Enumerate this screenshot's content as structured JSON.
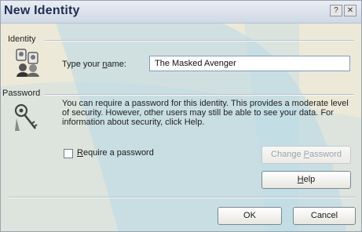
{
  "dialog": {
    "title": "New Identity",
    "title_help_glyph": "?",
    "title_close_glyph": "✕"
  },
  "identity": {
    "group_label": "Identity",
    "name_label_pre": "Type your ",
    "name_label_accel": "n",
    "name_label_post": "ame:",
    "name_value": "The Masked Avenger"
  },
  "password": {
    "group_label": "Password",
    "description": "You can require a password for this identity.  This provides a moderate level of security. However, other users may still be able to see your data. For information about security, click Help.",
    "checkbox_accel": "R",
    "checkbox_label_rest": "equire a password",
    "checkbox_checked": false,
    "change_password_pre": "Change ",
    "change_password_accel": "P",
    "change_password_post": "assword",
    "help_accel": "H",
    "help_label_rest": "elp"
  },
  "footer": {
    "ok_label": "OK",
    "cancel_label": "Cancel"
  },
  "icons": {
    "identity_icon": "people-icon",
    "password_icon": "keys-icon"
  },
  "colors": {
    "dialog_bg": "#ece9d8",
    "title_text": "#1f2f52",
    "watermark": "#b9d9e8"
  }
}
